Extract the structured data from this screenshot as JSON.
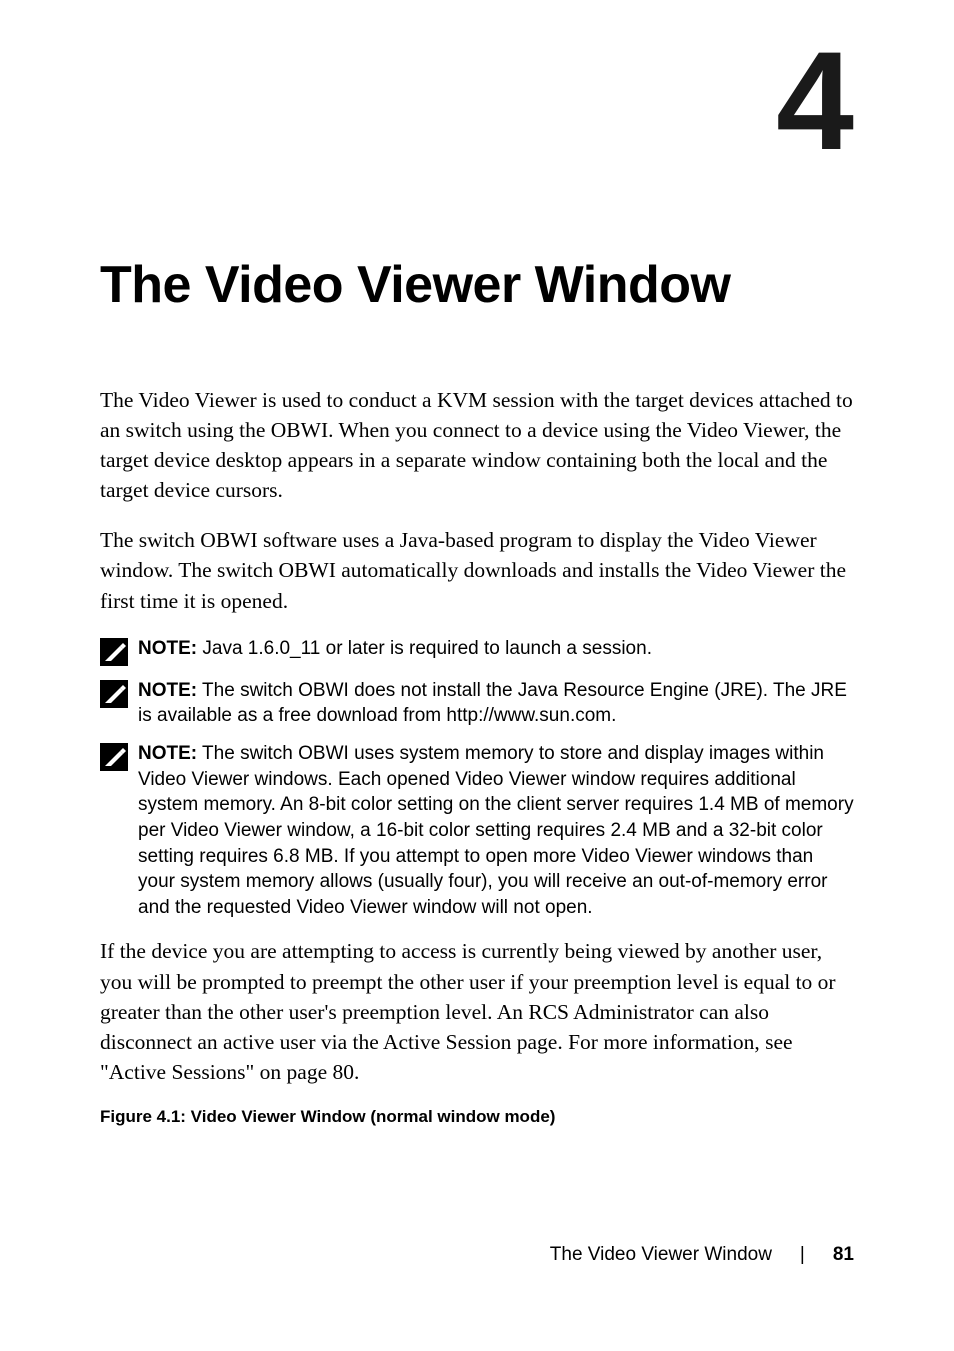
{
  "chapter": {
    "number": "4"
  },
  "title": "The Video Viewer Window",
  "paragraphs": {
    "p1": "The Video Viewer is used to conduct a KVM session with the target devices attached to an switch using the OBWI. When you connect to a device using the Video Viewer, the target device desktop appears in a separate window containing both the local and the target device cursors.",
    "p2": "The switch OBWI software uses a Java-based program to display the Video Viewer window. The switch  OBWI automatically downloads and installs the Video Viewer the first time it is opened.",
    "p3": "If the device you are attempting to access is currently being viewed by another user, you will be prompted to preempt the other user if your preemption level is equal to or greater than the other user's preemption level. An RCS Administrator can also disconnect an active user via the Active Session page. For more information, see \"Active Sessions\" on page 80."
  },
  "notes": {
    "label": "NOTE:",
    "note1": " Java 1.6.0_11 or later is required to launch a session.",
    "note2": " The switch OBWI does not install the Java Resource Engine (JRE). The JRE is available as a free download from http://www.sun.com.",
    "note3": " The switch OBWI uses system memory to store and display images within Video Viewer windows. Each opened Video Viewer window requires additional system memory. An 8-bit color setting on the client server requires 1.4 MB of memory per Video Viewer window, a 16-bit color setting requires 2.4 MB and a 32-bit color setting requires 6.8 MB. If you attempt to open more Video Viewer windows than your system memory allows (usually four), you will receive an out-of-memory error and the requested Video Viewer window will not open."
  },
  "figure": {
    "caption": "Figure 4.1: Video Viewer Window (normal window mode)"
  },
  "footer": {
    "section": "The Video Viewer Window",
    "page": "81"
  }
}
